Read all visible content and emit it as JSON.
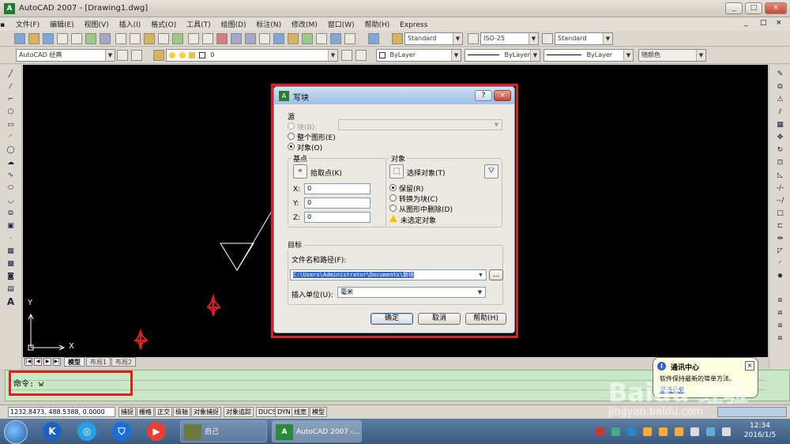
{
  "window": {
    "title": "AutoCAD 2007 - [Drawing1.dwg]",
    "controls": [
      "_",
      "□",
      "×"
    ],
    "doc_controls": [
      "_",
      "□",
      "×"
    ]
  },
  "menu": [
    "文件(F)",
    "编辑(E)",
    "视图(V)",
    "插入(I)",
    "格式(O)",
    "工具(T)",
    "绘图(D)",
    "标注(N)",
    "修改(M)",
    "窗口(W)",
    "帮助(H)",
    "Express"
  ],
  "toolbar1": {
    "text_style": "Standard",
    "dim_style": "ISO-25",
    "table_style": "Standard"
  },
  "toolbar2": {
    "workspace": "AutoCAD 经典",
    "layer": "0",
    "color": "ByLayer",
    "linetype": "ByLayer",
    "lineweight": "ByLayer",
    "plotstyle": "随颜色"
  },
  "ucs": {
    "x": "X",
    "y": "Y"
  },
  "layout_tabs": [
    "模型",
    "布局1",
    "布局2"
  ],
  "command": {
    "text": "命令: w"
  },
  "status": {
    "coords": "1232.8473, 488.5388, 0.0000",
    "buttons": [
      "捕捉",
      "栅格",
      "正交",
      "极轴",
      "对象捕捉",
      "对象追踪",
      "DUCS",
      "DYN",
      "线宽",
      "模型"
    ]
  },
  "dialog": {
    "title": "写块",
    "help_btn": "?",
    "close_btn": "×",
    "source_label": "源",
    "source_block": "块(B):",
    "source_entire": "整个图形(E)",
    "source_objects": "对象(O)",
    "base_label": "基点",
    "pick_point": "拾取点(K)",
    "x_label": "X:",
    "y_label": "Y:",
    "z_label": "Z:",
    "x_value": "0",
    "y_value": "0",
    "z_value": "0",
    "objects_label": "对象",
    "select_objects": "选择对象(T)",
    "retain": "保留(R)",
    "convert": "转换为块(C)",
    "delete": "从图形中删除(D)",
    "none_selected": "未选定对象",
    "dest_label": "目标",
    "filename_label": "文件名和路径(F):",
    "filename_value": "C:\\Users\\Administrator\\Documents\\新块",
    "browse": "...",
    "units_label": "插入单位(U):",
    "units_value": "毫米",
    "ok": "确定",
    "cancel": "取消",
    "help": "帮助(H)"
  },
  "notification": {
    "title": "通讯中心",
    "body": "软件保持最新的简单方法。",
    "link": "单击此处"
  },
  "taskbar": {
    "task1": "自己",
    "task2": "AutoCAD 2007 -...",
    "time": "12:34",
    "date": "2016/1/5"
  },
  "watermark": {
    "main": "Baidu 经验",
    "sub": "jingyan.baidu.com"
  }
}
